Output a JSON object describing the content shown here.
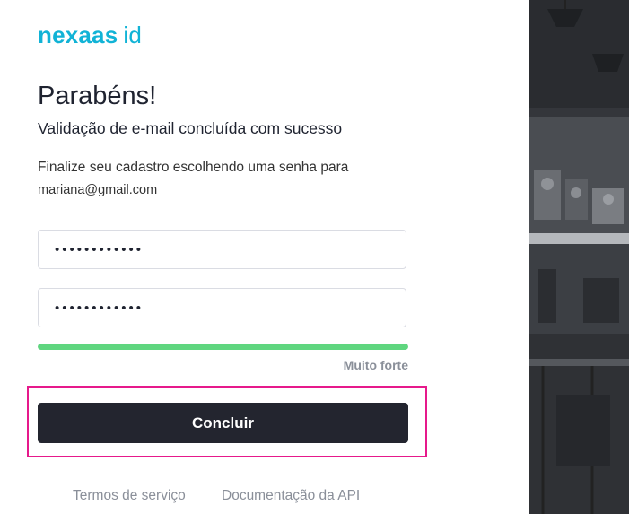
{
  "logo": {
    "brand": "nexaas",
    "suffix": "id"
  },
  "heading": {
    "title": "Parabéns!",
    "subtitle": "Validação de e-mail concluída com sucesso"
  },
  "instructions": {
    "line1": "Finalize seu cadastro escolhendo uma senha para",
    "email": "mariana@gmail.com"
  },
  "form": {
    "password_value": "••••••••••••",
    "confirm_password_value": "••••••••••••",
    "strength": {
      "label": "Muito forte",
      "level": 1.0,
      "color": "#5fd67f"
    },
    "submit_label": "Concluir"
  },
  "footer": {
    "terms_label": "Termos de serviço",
    "api_docs_label": "Documentação da API"
  },
  "colors": {
    "brand": "#11b3d6",
    "button": "#23252f",
    "highlight": "#e6198b"
  }
}
